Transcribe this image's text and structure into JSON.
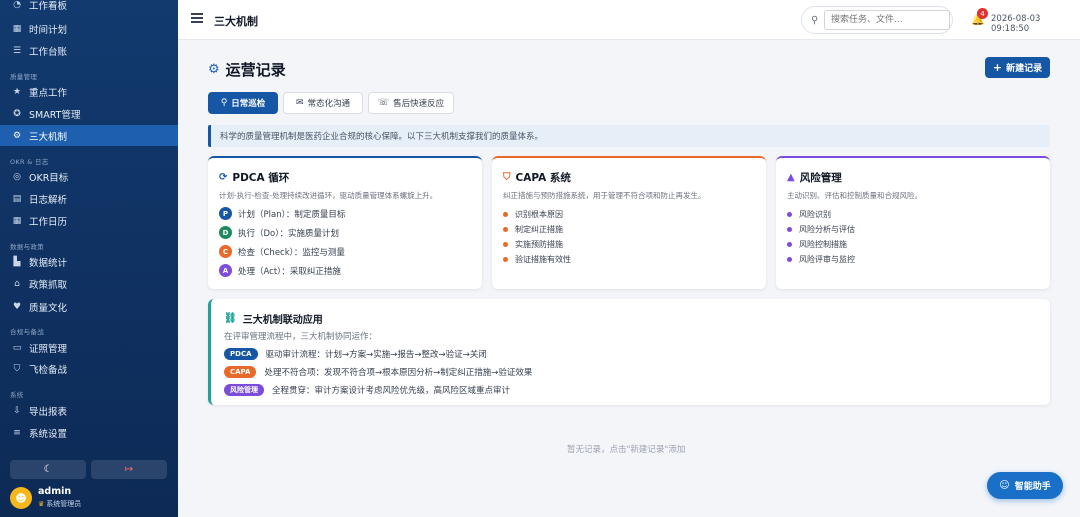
{
  "sidebar": {
    "items": [
      {
        "label": "工作看板",
        "icon": "dashboard-icon",
        "glyph": "◔"
      },
      {
        "label": "时间计划",
        "icon": "calendar-icon",
        "glyph": "▦"
      },
      {
        "label": "工作台账",
        "icon": "list-icon",
        "glyph": "☰"
      },
      {
        "label": "重点工作",
        "icon": "star-icon",
        "glyph": "★"
      },
      {
        "label": "SMART管理",
        "icon": "bulb-icon",
        "glyph": "✪"
      },
      {
        "label": "三大机制",
        "icon": "cogs-icon",
        "glyph": "⚙"
      },
      {
        "label": "OKR目标",
        "icon": "target-icon",
        "glyph": "◎"
      },
      {
        "label": "日志解析",
        "icon": "document-icon",
        "glyph": "▤"
      },
      {
        "label": "工作日历",
        "icon": "calendar-icon",
        "glyph": "▦"
      },
      {
        "label": "数据统计",
        "icon": "chart-icon",
        "glyph": "▙"
      },
      {
        "label": "政策抓取",
        "icon": "bank-icon",
        "glyph": "⌂"
      },
      {
        "label": "质量文化",
        "icon": "heart-icon",
        "glyph": "♥"
      },
      {
        "label": "证照管理",
        "icon": "id-card-icon",
        "glyph": "▭"
      },
      {
        "label": "飞检备战",
        "icon": "shield-icon",
        "glyph": "⛉"
      },
      {
        "label": "导出报表",
        "icon": "export-icon",
        "glyph": "⇩"
      },
      {
        "label": "系统设置",
        "icon": "sliders-icon",
        "glyph": "≡"
      }
    ],
    "sections": [
      "质量管理",
      "OKR & 日志",
      "数据与政策",
      "合规与备战",
      "系统"
    ],
    "theme_icon": "☾",
    "logout_icon": "↦",
    "user": {
      "name": "admin",
      "role": "系统管理员",
      "avatar_glyph": "☻",
      "crown": "♛"
    }
  },
  "header": {
    "title": "三大机制",
    "search_placeholder": "搜索任务、文件...",
    "notification_count": "4",
    "datetime": "2026-08-03 09:18:50"
  },
  "main": {
    "title": "运营记录",
    "new_button": "新建记录",
    "tabs": [
      {
        "label": "日常巡检",
        "glyph": "⚲"
      },
      {
        "label": "常态化沟通",
        "glyph": "✉"
      },
      {
        "label": "售后快速反应",
        "glyph": "☏"
      }
    ],
    "info": "科学的质量管理机制是医药企业合规的核心保障。以下三大机制支撑我们的质量体系。",
    "cards": {
      "pdca": {
        "title": "PDCA 循环",
        "desc": "计划-执行-检查-处理持续改进循环，驱动质量管理体系螺旋上升。",
        "rows": [
          {
            "letter": "P",
            "text": "计划（Plan）：制定质量目标"
          },
          {
            "letter": "D",
            "text": "执行（Do）：实施质量计划"
          },
          {
            "letter": "C",
            "text": "检查（Check）：监控与测量"
          },
          {
            "letter": "A",
            "text": "处理（Act）：采取纠正措施"
          }
        ]
      },
      "capa": {
        "title": "CAPA 系统",
        "desc": "纠正措施与预防措施系统，用于管理不符合项和防止再发生。",
        "items": [
          "识别根本原因",
          "制定纠正措施",
          "实施预防措施",
          "验证措施有效性"
        ]
      },
      "risk": {
        "title": "风险管理",
        "desc": "主动识别、评估和控制质量和合规风险。",
        "items": [
          "风险识别",
          "风险分析与评估",
          "风险控制措施",
          "风险评审与监控"
        ]
      }
    },
    "linkage": {
      "title": "三大机制联动应用",
      "subtitle": "在评审管理流程中，三大机制协同运作：",
      "rows": [
        {
          "badge": "PDCA",
          "text": "驱动审计流程：计划→方案→实施→报告→整改→验证→关闭"
        },
        {
          "badge": "CAPA",
          "text": "处理不符合项：发现不符合项→根本原因分析→制定纠正措施→验证效果"
        },
        {
          "badge": "风险管理",
          "text": "全程贯穿：审计方案设计考虑风险优先级，高风险区域重点审计"
        }
      ]
    },
    "empty_text": "暂无记录，点击\"新建记录\"添加",
    "assistant": "智能助手"
  },
  "colors": {
    "primary": "#1557a4",
    "teal": "#1fa29a",
    "orange": "#e8692a",
    "purple": "#7c4ddb",
    "green": "#1f8a5b",
    "danger": "#e03131"
  }
}
